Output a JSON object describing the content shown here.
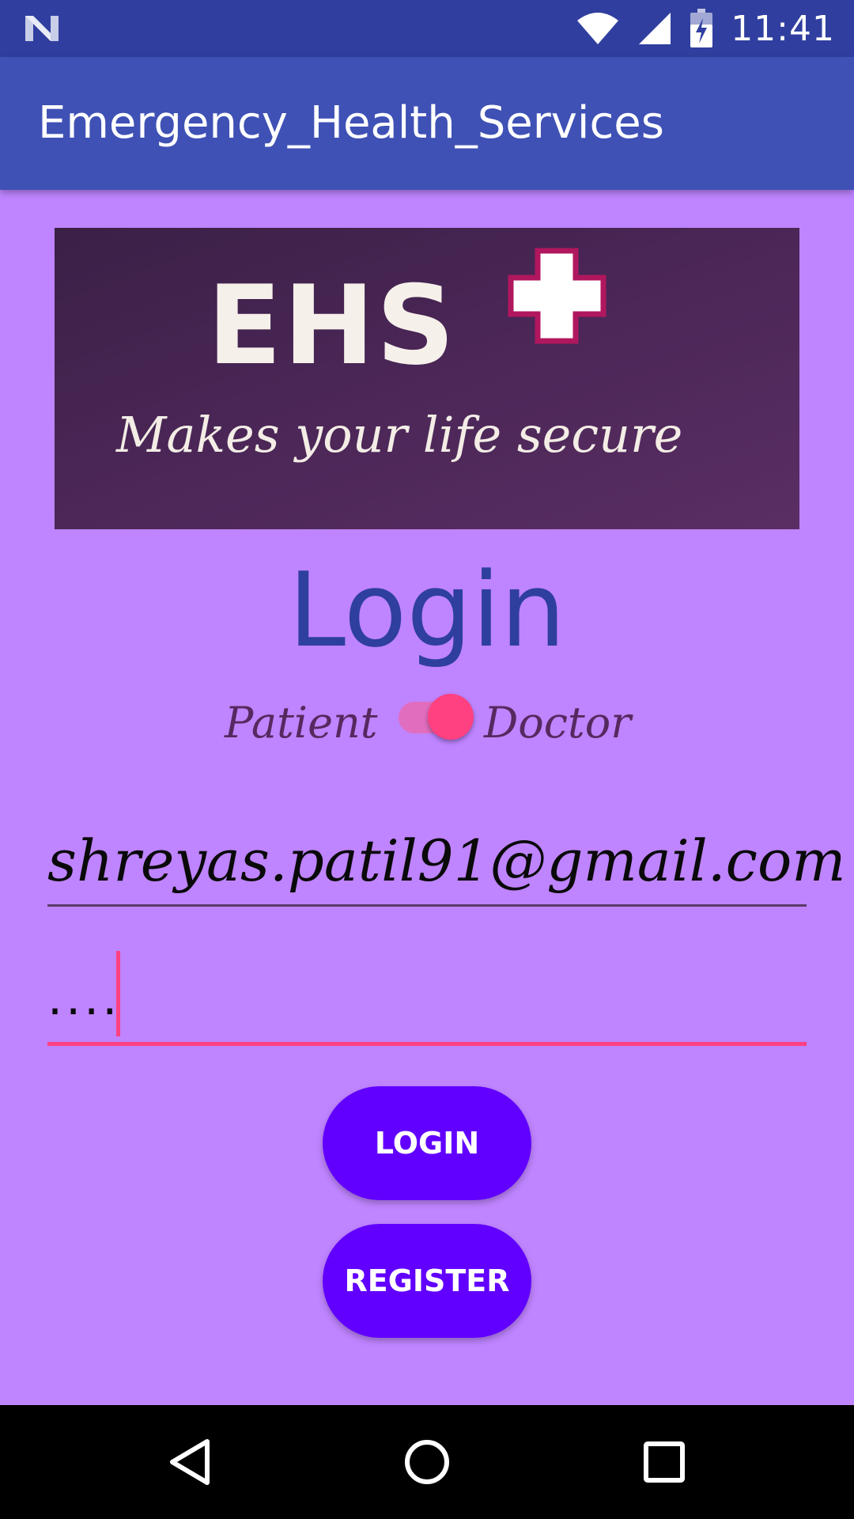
{
  "status_bar": {
    "time": "11:41",
    "icons": [
      "n-notification-icon",
      "wifi-icon",
      "cell-signal-icon",
      "battery-charging-icon"
    ]
  },
  "app_bar": {
    "title": "Emergency_Health_Services"
  },
  "banner": {
    "logo_text": "EHS",
    "tagline": "Makes your life secure",
    "icon": "medical-cross-icon"
  },
  "login": {
    "heading": "Login",
    "role_switch": {
      "left_label": "Patient",
      "right_label": "Doctor",
      "checked": true
    },
    "email_value": "shreyas.patil91@gmail.com",
    "password_mask": "....",
    "login_button": "LOGIN",
    "register_button": "REGISTER"
  },
  "nav_bar": {
    "icons": [
      "back-icon",
      "home-icon",
      "recents-icon"
    ]
  },
  "colors": {
    "status_bar": "#303f9f",
    "app_bar": "#3f51b5",
    "background": "#bf84ff",
    "accent": "#ff4081",
    "button": "#6200ff",
    "heading": "#2f3f9e"
  }
}
